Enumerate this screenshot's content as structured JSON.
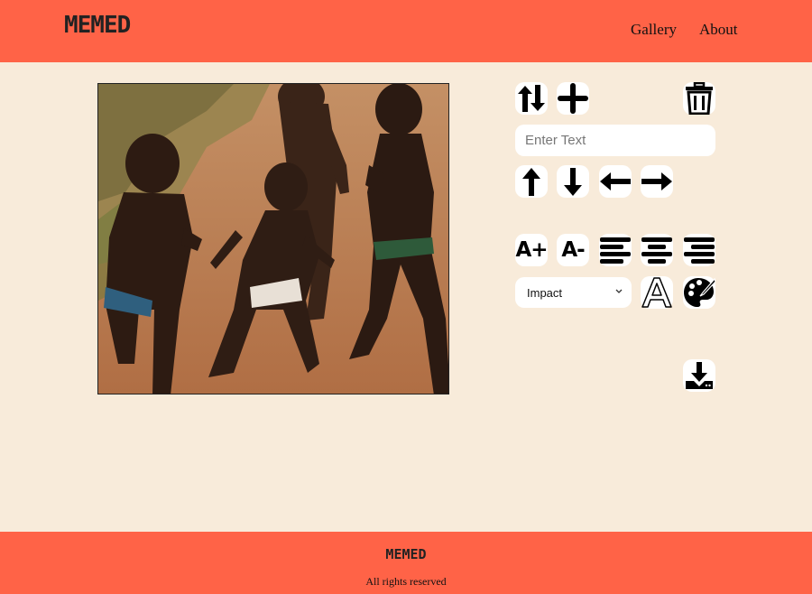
{
  "header": {
    "logo": "MEMED",
    "nav": [
      {
        "label": "Gallery"
      },
      {
        "label": "About"
      }
    ]
  },
  "meme": {
    "image_description": "photo"
  },
  "controls": {
    "text_input": {
      "placeholder": "Enter Text",
      "value": ""
    },
    "font_select": {
      "selected": "Impact"
    },
    "icons": [
      "swap-lines-icon",
      "add-line-icon",
      "trash-icon",
      "arrow-up-icon",
      "arrow-down-icon",
      "arrow-left-icon",
      "arrow-right-icon",
      "font-increase-icon",
      "font-decrease-icon",
      "align-left-icon",
      "align-center-icon",
      "align-right-icon",
      "stroke-icon",
      "palette-icon",
      "download-icon"
    ],
    "font_increase_label": "A+",
    "font_decrease_label": "A-",
    "stroke_label": "A"
  },
  "footer": {
    "logo": "MEMED",
    "rights": "All rights reserved"
  },
  "colors": {
    "header_bg": "#ff6347",
    "page_bg": "#f8ebda",
    "button_bg": "#ffffff"
  }
}
